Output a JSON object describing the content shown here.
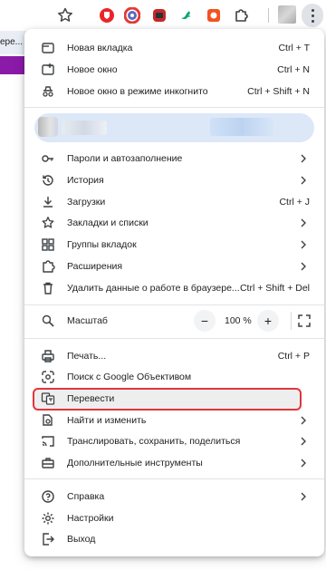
{
  "page": {
    "title_snippet": "ере..."
  },
  "toolbar": {
    "star_icon": "star-icon",
    "extensions": [
      "shield-red",
      "camera-multicolor",
      "extension-red",
      "bird-green",
      "record-red",
      "puzzle-icon"
    ]
  },
  "menu": {
    "group1": [
      {
        "label": "Новая вкладка",
        "shortcut": "Ctrl + T",
        "icon": "new-tab-icon"
      },
      {
        "label": "Новое окно",
        "shortcut": "Ctrl + N",
        "icon": "new-window-icon"
      },
      {
        "label": "Новое окно в режиме инкогнито",
        "shortcut": "Ctrl + Shift + N",
        "icon": "incognito-icon"
      }
    ],
    "group2": [
      {
        "label": "Пароли и автозаполнение",
        "shortcut": "",
        "icon": "key-icon",
        "submenu": true
      },
      {
        "label": "История",
        "shortcut": "",
        "icon": "history-icon",
        "submenu": true
      },
      {
        "label": "Загрузки",
        "shortcut": "Ctrl + J",
        "icon": "download-icon"
      },
      {
        "label": "Закладки и списки",
        "shortcut": "",
        "icon": "star-outline-icon",
        "submenu": true
      },
      {
        "label": "Группы вкладок",
        "shortcut": "",
        "icon": "tab-groups-icon",
        "submenu": true
      },
      {
        "label": "Расширения",
        "shortcut": "",
        "icon": "extensions-icon",
        "submenu": true
      },
      {
        "label": "Удалить данные о работе в браузере...",
        "shortcut": "Ctrl + Shift + Del",
        "icon": "trash-icon"
      }
    ],
    "zoom": {
      "label": "Масштаб",
      "value": "100 %",
      "minus": "−",
      "plus": "+"
    },
    "group3": [
      {
        "label": "Печать...",
        "shortcut": "Ctrl + P",
        "icon": "print-icon"
      },
      {
        "label": "Поиск с Google Объективом",
        "shortcut": "",
        "icon": "lens-icon"
      },
      {
        "label": "Перевести",
        "shortcut": "",
        "icon": "translate-icon",
        "highlighted": true
      },
      {
        "label": "Найти и изменить",
        "shortcut": "",
        "icon": "find-icon",
        "submenu": true
      },
      {
        "label": "Транслировать, сохранить, поделиться",
        "shortcut": "",
        "icon": "cast-icon",
        "submenu": true
      },
      {
        "label": "Дополнительные инструменты",
        "shortcut": "",
        "icon": "toolbox-icon",
        "submenu": true
      }
    ],
    "group4": [
      {
        "label": "Справка",
        "shortcut": "",
        "icon": "help-icon",
        "submenu": true
      },
      {
        "label": "Настройки",
        "shortcut": "",
        "icon": "settings-icon"
      },
      {
        "label": "Выход",
        "shortcut": "",
        "icon": "exit-icon"
      }
    ]
  },
  "colors": {
    "highlight_border": "#e0363c",
    "profile_bg": "#dce7f8",
    "purple_band": "#8a1aa8"
  }
}
